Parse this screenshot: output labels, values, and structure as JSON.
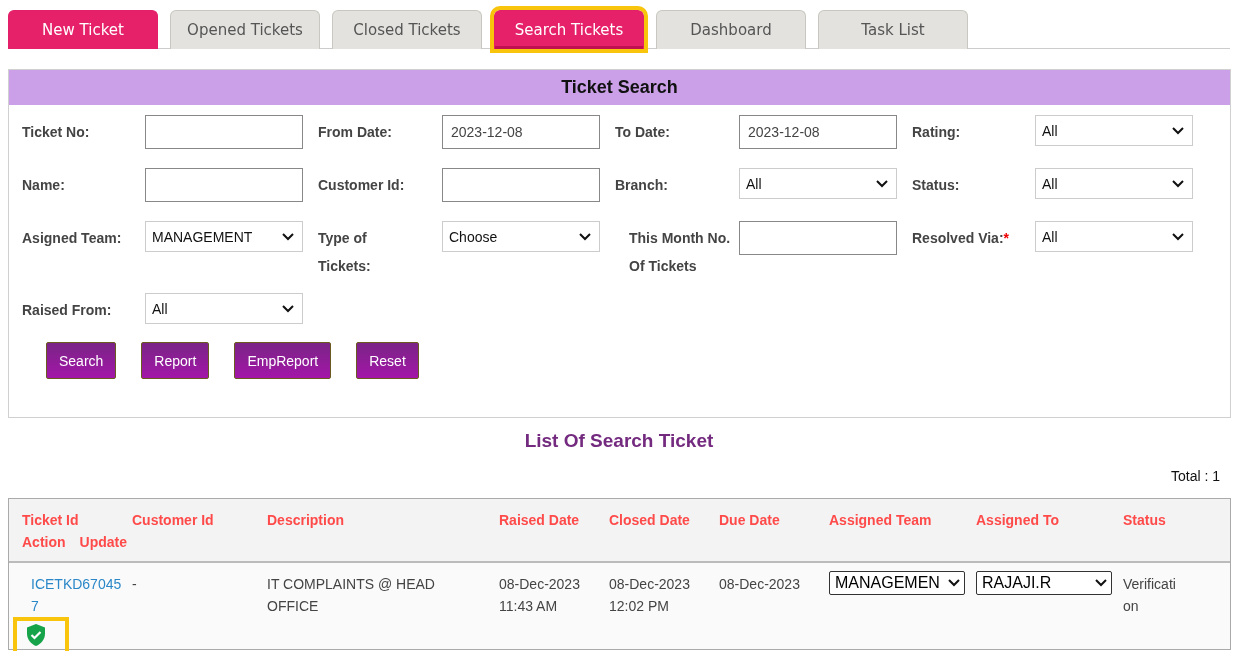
{
  "tabs": [
    {
      "label": "New Ticket",
      "selected": false,
      "kind": "primary",
      "highlighted": false
    },
    {
      "label": "Opened Tickets",
      "selected": false,
      "kind": "plain",
      "highlighted": false
    },
    {
      "label": "Closed Tickets",
      "selected": false,
      "kind": "plain",
      "highlighted": false
    },
    {
      "label": "Search Tickets",
      "selected": true,
      "kind": "primary",
      "highlighted": true
    },
    {
      "label": "Dashboard",
      "selected": false,
      "kind": "plain",
      "highlighted": false
    },
    {
      "label": "Task List",
      "selected": false,
      "kind": "plain",
      "highlighted": false
    }
  ],
  "search_panel": {
    "title": "Ticket Search",
    "rows": [
      [
        {
          "label": "Ticket No:",
          "kind": "input"
        },
        {
          "label": "From Date:",
          "kind": "input",
          "value": "2023-12-08"
        },
        {
          "label": "To Date:",
          "kind": "input",
          "value": "2023-12-08"
        },
        {
          "label": "Rating:",
          "kind": "select",
          "value": "All"
        }
      ],
      [
        {
          "label": "Name:",
          "kind": "input"
        },
        {
          "label": "Customer Id:",
          "kind": "input"
        },
        {
          "label": "Branch:",
          "kind": "select",
          "value": "All"
        },
        {
          "label": "Status:",
          "kind": "select",
          "value": "All"
        }
      ],
      [
        {
          "label": "Asigned Team:",
          "kind": "select",
          "value": "MANAGEMENT"
        },
        {
          "label": "Type of Tickets:",
          "kind": "select",
          "value": "Choose"
        },
        {
          "label": "This Month No. Of Tickets",
          "kind": "input"
        },
        {
          "label": "Resolved Via:",
          "kind": "select",
          "value": "All",
          "required_mark": "*"
        }
      ],
      [
        {
          "label": "Raised From:",
          "kind": "select",
          "value": "All"
        }
      ]
    ],
    "buttons": [
      "Search",
      "Report",
      "EmpReport",
      "Reset"
    ]
  },
  "results": {
    "title": "List Of Search Ticket",
    "total": "Total : 1",
    "columns": [
      "Ticket Id",
      "Customer Id",
      "Description",
      "Raised Date",
      "Closed Date",
      "Due Date",
      "Assigned Team",
      "Assigned To",
      "Status"
    ],
    "sub_columns": [
      "Action",
      "Update"
    ],
    "rows": [
      {
        "ticket_id": "ICETKD670457",
        "customer_id": "-",
        "description": "IT COMPLAINTS @ HEAD OFFICE",
        "raised_date": "08-Dec-2023",
        "raised_time": "11:43 AM",
        "closed_date": "08-Dec-2023",
        "closed_time": "12:02 PM",
        "due_date": "08-Dec-2023",
        "assigned_team": "MANAGEMEN",
        "assigned_to": "RAJAJI.R",
        "status": "Verification",
        "verified": true,
        "action_highlighted": true
      }
    ]
  }
}
